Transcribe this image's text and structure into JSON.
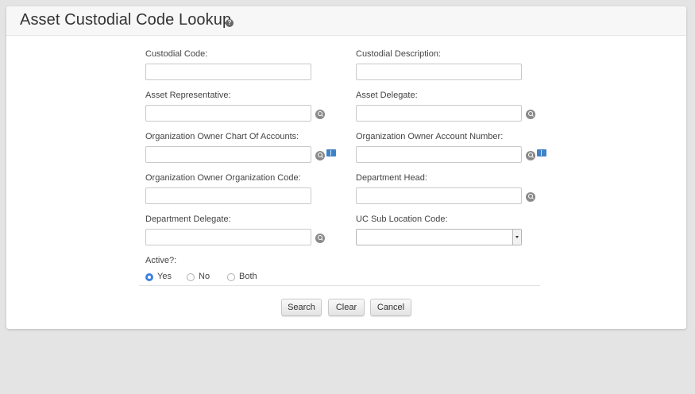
{
  "header": {
    "title": "Asset Custodial Code Lookup"
  },
  "fields": {
    "custodial_code": {
      "label": "Custodial Code:",
      "value": ""
    },
    "custodial_description": {
      "label": "Custodial Description:",
      "value": ""
    },
    "asset_representative": {
      "label": "Asset Representative:",
      "value": ""
    },
    "asset_delegate": {
      "label": "Asset Delegate:",
      "value": ""
    },
    "org_owner_chart": {
      "label": "Organization Owner Chart Of Accounts:",
      "value": ""
    },
    "org_owner_account": {
      "label": "Organization Owner Account Number:",
      "value": ""
    },
    "org_owner_org_code": {
      "label": "Organization Owner Organization Code:",
      "value": ""
    },
    "department_head": {
      "label": "Department Head:",
      "value": ""
    },
    "department_delegate": {
      "label": "Department Delegate:",
      "value": ""
    },
    "uc_sub_location": {
      "label": "UC Sub Location Code:",
      "value": ""
    }
  },
  "active": {
    "label": "Active?:",
    "options": [
      "Yes",
      "No",
      "Both"
    ],
    "selected": "Yes"
  },
  "buttons": {
    "search": "Search",
    "clear": "Clear",
    "cancel": "Cancel"
  },
  "colors": {
    "accent": "#3b82e4",
    "background": "#e4e4e4"
  }
}
